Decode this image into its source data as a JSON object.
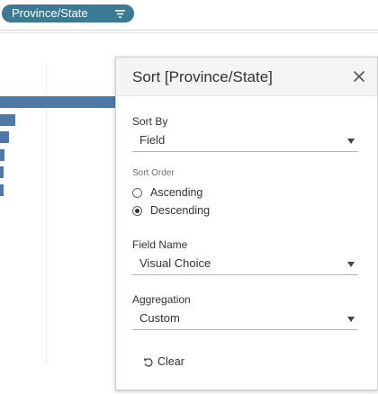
{
  "shelf": {
    "pill_label": "Province/State",
    "pill_icon": "sort-descending-icon",
    "pill_color": "#3a7a94"
  },
  "chart": {
    "bar_color": "#4e79a7",
    "bars": [
      {
        "rank": 1,
        "level": 1.0
      },
      {
        "rank": 2,
        "level": 0.13
      },
      {
        "rank": 3,
        "level": 0.08
      },
      {
        "rank": 4,
        "level": 0.04
      },
      {
        "rank": 5,
        "level": 0.035
      },
      {
        "rank": 6,
        "level": 0.03
      }
    ]
  },
  "sort_dialog": {
    "title": "Sort [Province/State]",
    "close_icon": "close-icon",
    "sort_by": {
      "label": "Sort By",
      "value": "Field"
    },
    "sort_order": {
      "label": "Sort Order",
      "options": [
        {
          "label": "Ascending",
          "selected": false
        },
        {
          "label": "Descending",
          "selected": true
        }
      ]
    },
    "field_name": {
      "label": "Field Name",
      "value": "Visual Choice"
    },
    "aggregation": {
      "label": "Aggregation",
      "value": "Custom"
    },
    "clear": {
      "label": "Clear",
      "icon": "undo-icon"
    }
  }
}
